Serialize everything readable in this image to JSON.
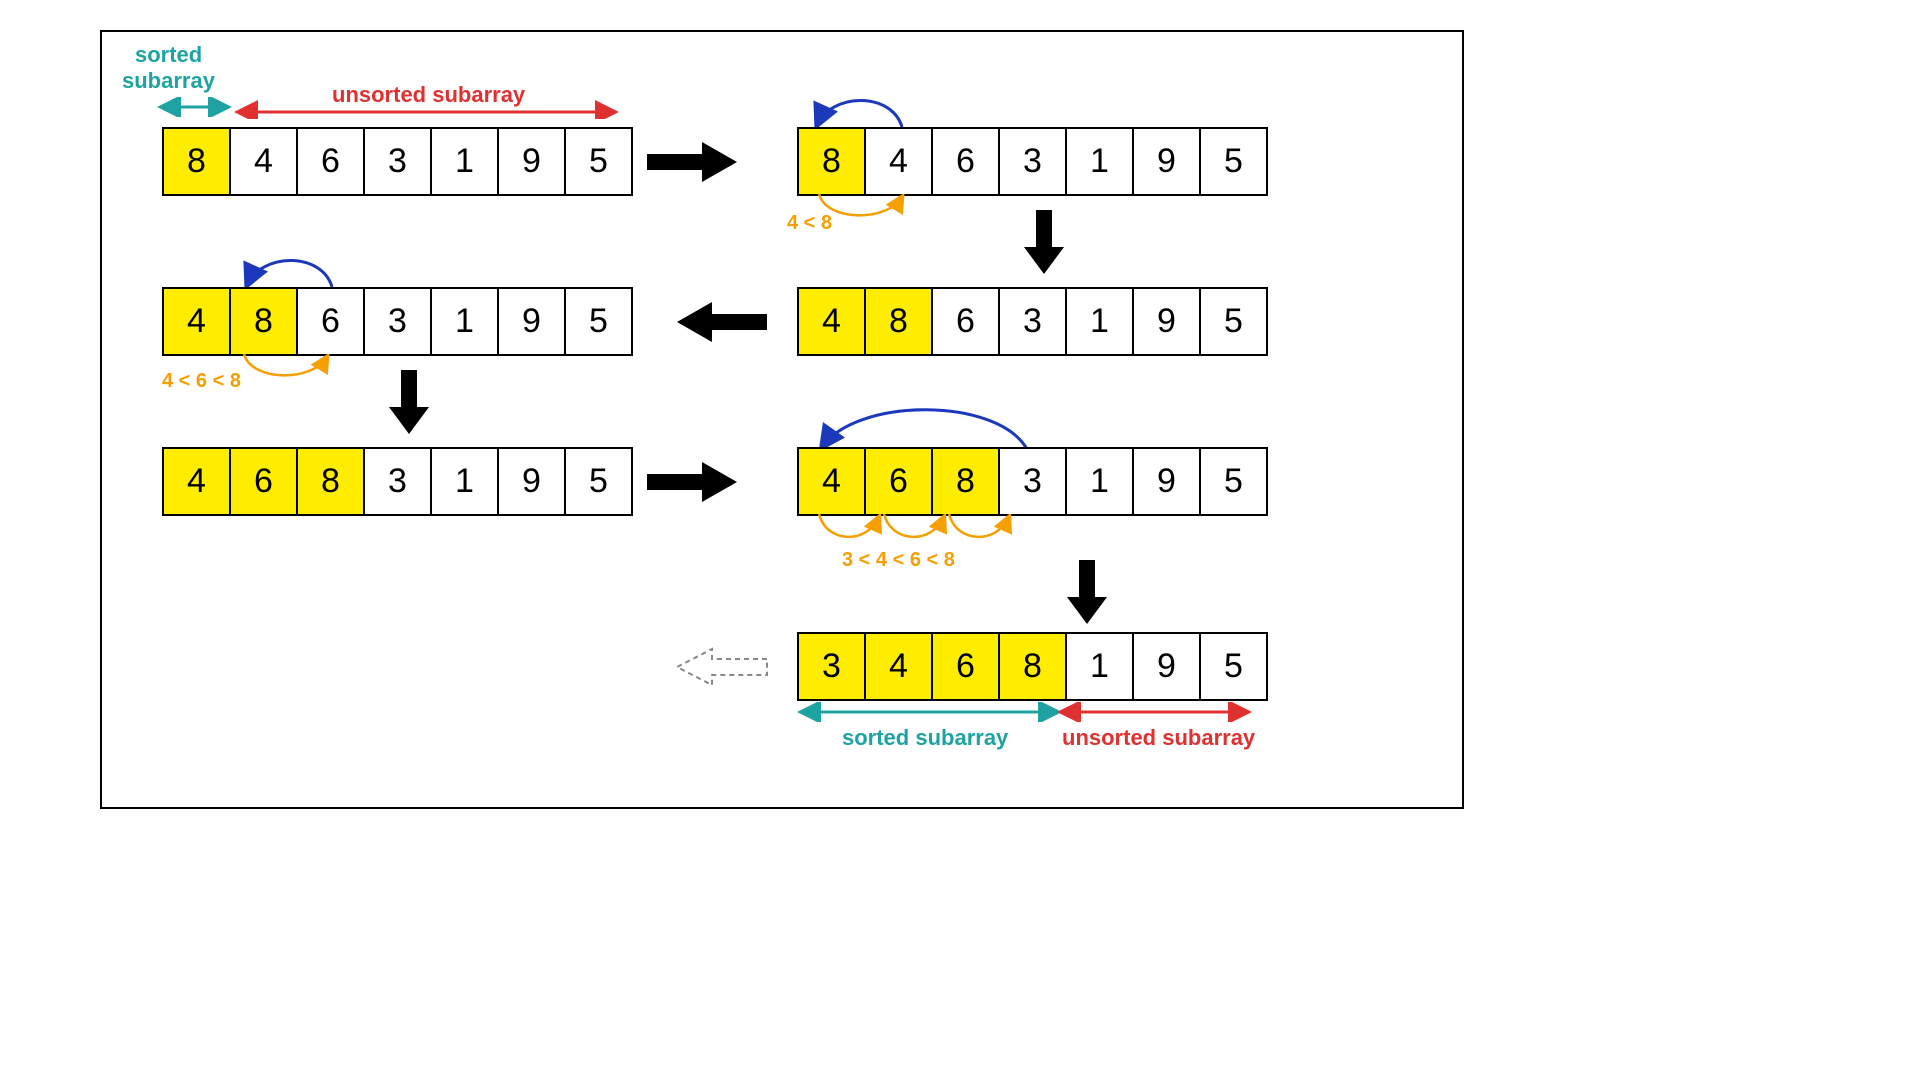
{
  "labels": {
    "sorted_top_1": "sorted",
    "sorted_top_2": "subarray",
    "unsorted_top": "unsorted subarray",
    "cmp1": "4 < 8",
    "cmp2": "4 < 6 < 8",
    "cmp3": "3 < 4 < 6 < 8",
    "sorted_bottom": "sorted subarray",
    "unsorted_bottom": "unsorted subarray"
  },
  "arrays": {
    "step1": [
      "8",
      "4",
      "6",
      "3",
      "1",
      "9",
      "5"
    ],
    "step2": [
      "8",
      "4",
      "6",
      "3",
      "1",
      "9",
      "5"
    ],
    "step3r": [
      "4",
      "8",
      "6",
      "3",
      "1",
      "9",
      "5"
    ],
    "step3l": [
      "4",
      "8",
      "6",
      "3",
      "1",
      "9",
      "5"
    ],
    "step4l": [
      "4",
      "6",
      "8",
      "3",
      "1",
      "9",
      "5"
    ],
    "step4r": [
      "4",
      "6",
      "8",
      "3",
      "1",
      "9",
      "5"
    ],
    "step5": [
      "3",
      "4",
      "6",
      "8",
      "1",
      "9",
      "5"
    ]
  },
  "sorted_counts": {
    "step1": 1,
    "step2": 1,
    "step3r": 2,
    "step3l": 2,
    "step4l": 3,
    "step4r": 3,
    "step5": 4
  },
  "colors": {
    "teal": "#1fa2a2",
    "red": "#e03131",
    "orange": "#f59f00",
    "blue": "#1c39bb",
    "yellow": "#ffed00"
  }
}
